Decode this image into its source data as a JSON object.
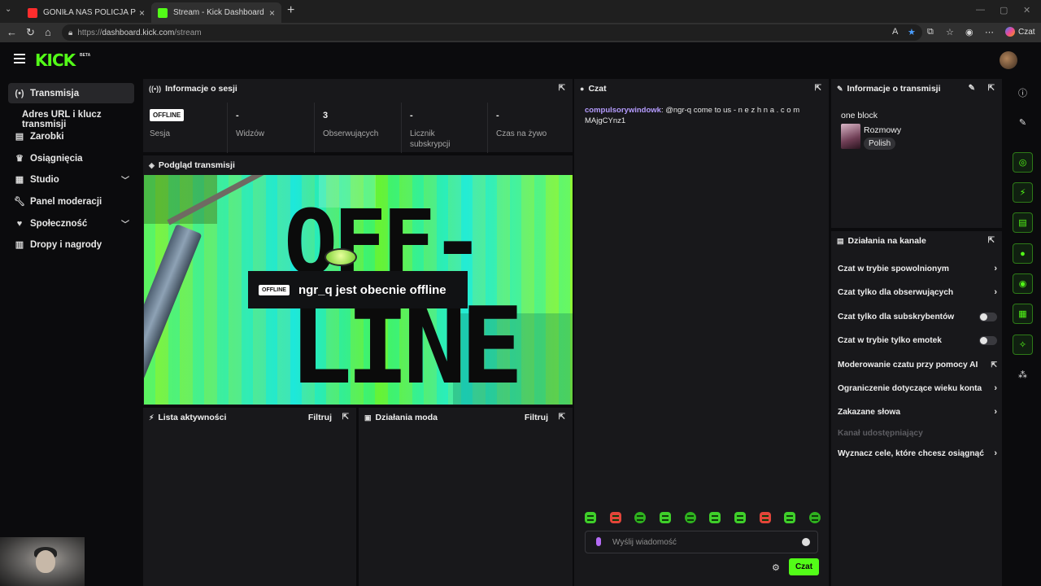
{
  "browser": {
    "tabs": [
      {
        "title": "GONIŁA NAS POLICJA PO CAŁEJ W",
        "active": false,
        "favicon_color": "#ff2d2d"
      },
      {
        "title": "Stream - Kick Dashboard",
        "active": true,
        "favicon_color": "#53fc18"
      }
    ],
    "url_prefix": "https://",
    "url_host": "dashboard.kick.com",
    "url_path": "/stream",
    "copilot_label": "Czat"
  },
  "app": {
    "logo_text": "KICK",
    "logo_badge": "BETA",
    "accent": "#53fc18"
  },
  "sidebar": {
    "items": [
      {
        "label": "Transmisja",
        "icon": "broadcast-icon",
        "active": true
      },
      {
        "label": "Adres URL i klucz transmisji",
        "sub": true
      },
      {
        "label": "Zarobki",
        "icon": "earnings-icon"
      },
      {
        "label": "Osiągnięcia",
        "icon": "trophy-icon"
      },
      {
        "label": "Studio",
        "icon": "studio-icon",
        "expandable": true
      },
      {
        "label": "Panel moderacji",
        "icon": "wrench-icon"
      },
      {
        "label": "Społeczność",
        "icon": "community-icon",
        "expandable": true
      },
      {
        "label": "Dropy i nagrody",
        "icon": "gift-icon"
      }
    ]
  },
  "session": {
    "title": "Informacje o sesji",
    "badge": "OFFLINE",
    "stats": [
      {
        "value": "",
        "label": "Sesja"
      },
      {
        "value": "-",
        "label": "Widzów"
      },
      {
        "value": "3",
        "label": "Obserwujących"
      },
      {
        "value": "-",
        "label": "Licznik subskrypcji"
      },
      {
        "value": "-",
        "label": "Czas na żywo"
      }
    ]
  },
  "preview": {
    "title": "Podgląd transmisji",
    "big_top": "OFF-",
    "big_bottom": "LINE",
    "overlay_badge": "OFFLINE",
    "overlay_text": "ngr_q jest obecnie offline"
  },
  "activity": {
    "title": "Lista aktywności",
    "filter_label": "Filtruj"
  },
  "mod_actions": {
    "title": "Działania moda",
    "filter_label": "Filtruj"
  },
  "chat": {
    "title": "Czat",
    "messages": [
      {
        "user": "compulsorywindowk",
        "text": ": @ngr-q come to us - n e z h n a . c o m MAjgCYnz1"
      }
    ],
    "input_placeholder": "Wyślij wiadomość",
    "send_label": "Czat"
  },
  "stream_info": {
    "title": "Informacje o transmisji",
    "stream_title": "one block",
    "category": "Rozmowy",
    "tag": "Polish"
  },
  "channel_actions": {
    "title": "Działania na kanale",
    "rows": [
      {
        "label": "Czat w trybie spowolnionym",
        "control": "chevron"
      },
      {
        "label": "Czat tylko dla obserwujących",
        "control": "chevron"
      },
      {
        "label": "Czat tylko dla subskrybentów",
        "control": "toggle"
      },
      {
        "label": "Czat w trybie tylko emotek",
        "control": "toggle"
      },
      {
        "label": "Moderowanie czatu przy pomocy AI",
        "control": "external"
      },
      {
        "label": "Ograniczenie dotyczące wieku konta",
        "control": "chevron"
      },
      {
        "label": "Zakazane słowa",
        "control": "chevron"
      },
      {
        "label": "Kanał udostępniający",
        "control": "none",
        "disabled": true
      },
      {
        "label": "Wyznacz cele, które chcesz osiągnąć",
        "control": "chevron"
      }
    ]
  }
}
